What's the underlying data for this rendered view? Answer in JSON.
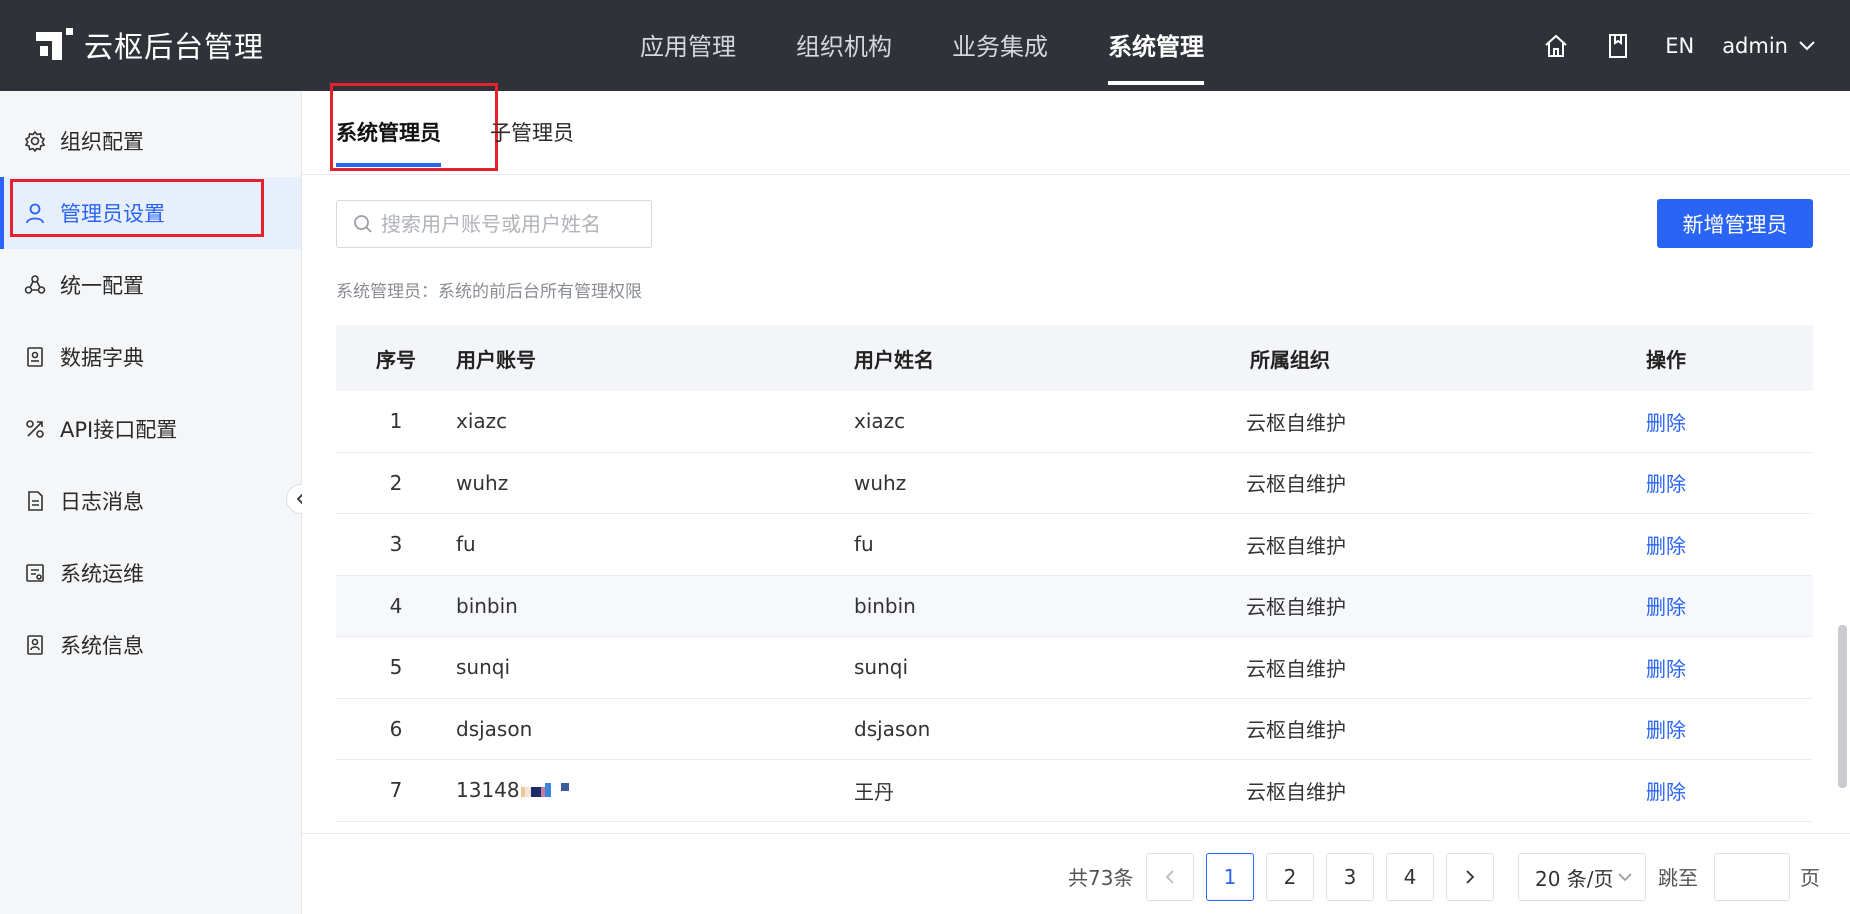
{
  "header": {
    "app_title": "云枢后台管理",
    "nav": [
      {
        "label": "应用管理",
        "active": false
      },
      {
        "label": "组织机构",
        "active": false
      },
      {
        "label": "业务集成",
        "active": false
      },
      {
        "label": "系统管理",
        "active": true
      }
    ],
    "lang": "EN",
    "user": "admin"
  },
  "sidebar": {
    "items": [
      {
        "label": "组织配置",
        "icon": "gear-icon"
      },
      {
        "label": "管理员设置",
        "icon": "user-icon",
        "active": true
      },
      {
        "label": "统一配置",
        "icon": "network-icon"
      },
      {
        "label": "数据字典",
        "icon": "dictionary-icon"
      },
      {
        "label": "API接口配置",
        "icon": "api-icon"
      },
      {
        "label": "日志消息",
        "icon": "log-icon"
      },
      {
        "label": "系统运维",
        "icon": "ops-icon"
      },
      {
        "label": "系统信息",
        "icon": "info-icon"
      }
    ]
  },
  "tabs": [
    {
      "label": "系统管理员",
      "active": true
    },
    {
      "label": "子管理员",
      "active": false
    }
  ],
  "search": {
    "placeholder": "搜索用户账号或用户姓名",
    "value": ""
  },
  "add_button": "新增管理员",
  "description": "系统管理员：系统的前后台所有管理权限",
  "table": {
    "columns": [
      "序号",
      "用户账号",
      "用户姓名",
      "所属组织",
      "操作"
    ],
    "rows": [
      {
        "idx": "1",
        "account": "xiazc",
        "name": "xiazc",
        "org": "云枢自维护",
        "action": "删除"
      },
      {
        "idx": "2",
        "account": "wuhz",
        "name": "wuhz",
        "org": "云枢自维护",
        "action": "删除"
      },
      {
        "idx": "3",
        "account": "fu",
        "name": "fu",
        "org": "云枢自维护",
        "action": "删除"
      },
      {
        "idx": "4",
        "account": "binbin",
        "name": "binbin",
        "org": "云枢自维护",
        "action": "删除"
      },
      {
        "idx": "5",
        "account": "sunqi",
        "name": "sunqi",
        "org": "云枢自维护",
        "action": "删除"
      },
      {
        "idx": "6",
        "account": "dsjason",
        "name": "dsjason",
        "org": "云枢自维护",
        "action": "删除"
      },
      {
        "idx": "7",
        "account": "13148",
        "name": "王丹",
        "org": "云枢自维护",
        "action": "删除"
      }
    ]
  },
  "pagination": {
    "total": "共73条",
    "pages": [
      "1",
      "2",
      "3",
      "4"
    ],
    "current": "1",
    "page_size": "20 条/页",
    "jump_label": "跳至",
    "jump_value": "",
    "page_suffix": "页"
  },
  "colors": {
    "accent": "#2a64f5",
    "header_bg": "#2f3238",
    "highlight": "#e5222b"
  }
}
